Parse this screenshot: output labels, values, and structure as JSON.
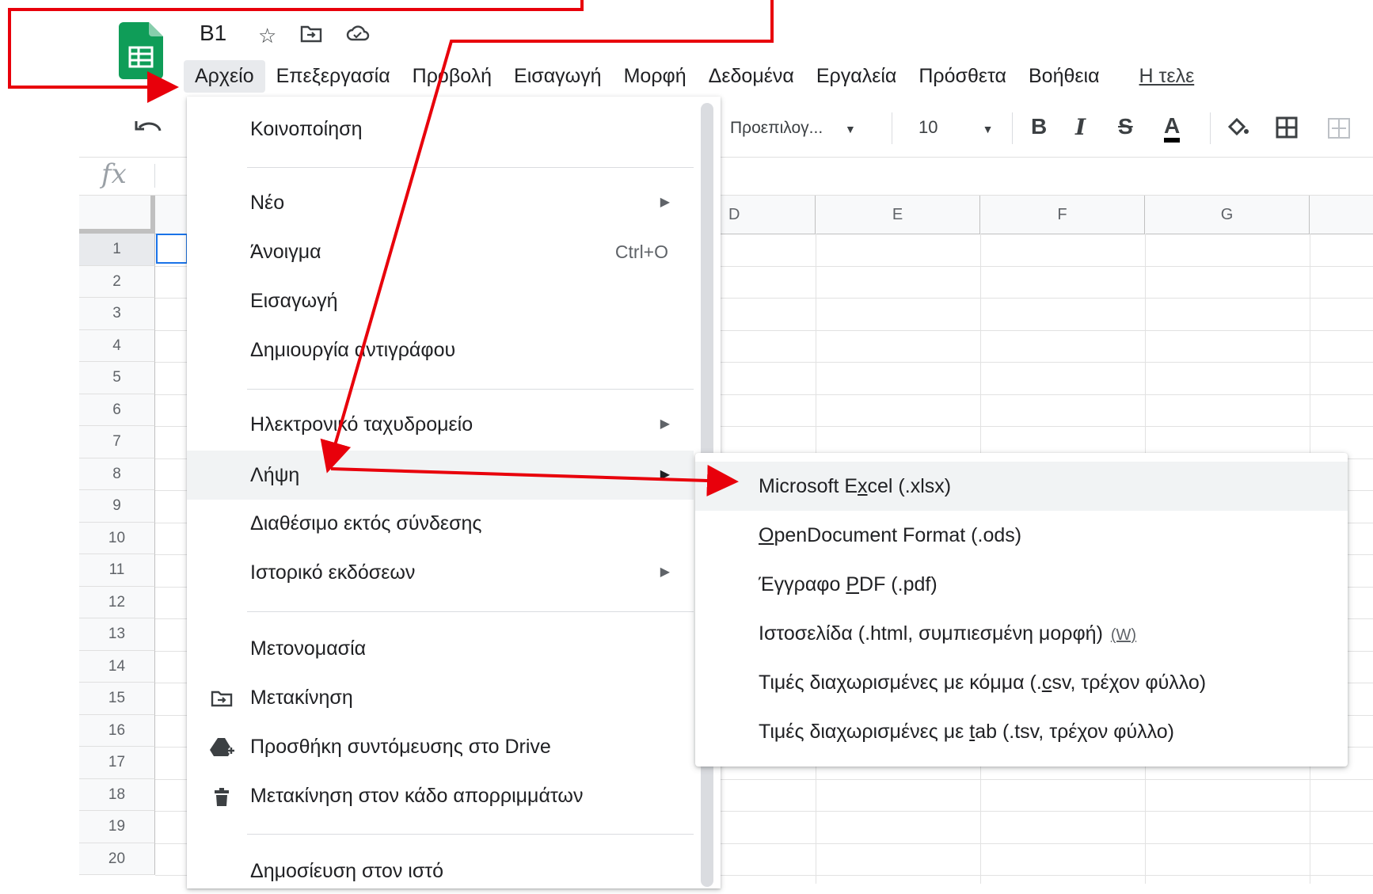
{
  "document": {
    "title": "B1"
  },
  "title_icons": [
    "star-icon",
    "move-folder-icon",
    "cloud-status-icon"
  ],
  "menubar": [
    {
      "label": "Αρχείο",
      "active": true
    },
    {
      "label": "Επεξεργασία"
    },
    {
      "label": "Προβολή"
    },
    {
      "label": "Εισαγωγή"
    },
    {
      "label": "Μορφή"
    },
    {
      "label": "Δεδομένα"
    },
    {
      "label": "Εργαλεία"
    },
    {
      "label": "Πρόσθετα"
    },
    {
      "label": "Βοήθεια"
    },
    {
      "label": "Η τελε"
    }
  ],
  "toolbar": {
    "font": "Προεπιλογ...",
    "font_size": "10",
    "bold": "B",
    "italic": "I",
    "strike": "S",
    "text_color": "A"
  },
  "formula_bar": {
    "fx": "fx"
  },
  "grid": {
    "columns": [
      "D",
      "E",
      "F",
      "G"
    ],
    "rows": [
      "1",
      "2",
      "3",
      "4",
      "5",
      "6",
      "7",
      "8",
      "9",
      "10",
      "11",
      "12",
      "13",
      "14",
      "15",
      "16",
      "17",
      "18",
      "19",
      "20"
    ]
  },
  "file_menu": {
    "share": "Κοινοποίηση",
    "new": "Νέο",
    "open": "Άνοιγμα",
    "open_shortcut": "Ctrl+O",
    "import": "Εισαγωγή",
    "make_copy": "Δημιουργία αντιγράφου",
    "email": "Ηλεκτρονικό ταχυδρομείο",
    "download": "Λήψη",
    "offline": "Διαθέσιμο εκτός σύνδεσης",
    "version_history": "Ιστορικό εκδόσεων",
    "rename": "Μετονομασία",
    "move": "Μετακίνηση",
    "drive_shortcut": "Προσθήκη συντόμευσης στο Drive",
    "trash": "Μετακίνηση στον κάδο απορριμμάτων",
    "publish": "Δημοσίευση στον ιστό"
  },
  "download_menu": {
    "xlsx": {
      "pre": "Microsoft E",
      "key": "x",
      "post": "cel (.xlsx)"
    },
    "ods": {
      "pre": "",
      "key": "O",
      "post": "penDocument Format (.ods)"
    },
    "pdf": {
      "pre": "Έγγραφο ",
      "key": "P",
      "post": "DF (.pdf)"
    },
    "html": {
      "label": "Ιστοσελίδα (.html, συμπιεσμένη μορφή)",
      "hint": "(W)"
    },
    "csv": {
      "pre": "Τιμές διαχωρισμένες με κόμμα (.",
      "key": "c",
      "post": "sv, τρέχον φύλλο)"
    },
    "tsv": {
      "pre": "Τιμές διαχωρισμένες με ",
      "key": "t",
      "post": "ab (.tsv, τρέχον φύλλο)"
    }
  },
  "colors": {
    "annotation": "#e8000b",
    "sheets_green": "#0f9d58",
    "selection": "#1a73e8"
  }
}
